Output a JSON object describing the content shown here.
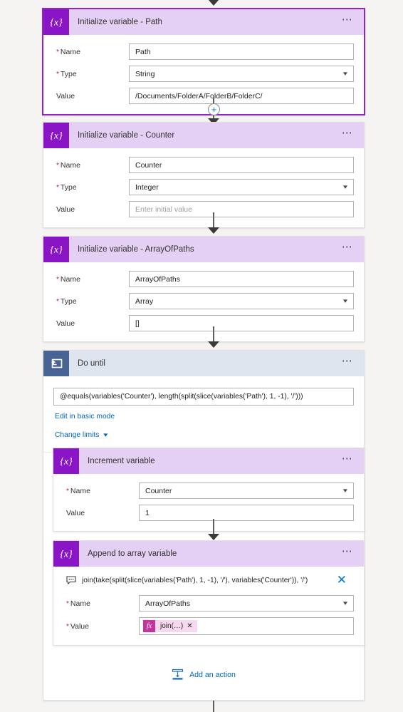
{
  "flow": {
    "cards": [
      {
        "id": "init-path",
        "title": "Initialize variable - Path",
        "icon": "variable-braces-icon",
        "selected": true,
        "fields": [
          {
            "label": "Name",
            "required": true,
            "value": "Path",
            "control": "text"
          },
          {
            "label": "Type",
            "required": true,
            "value": "String",
            "control": "dropdown"
          },
          {
            "label": "Value",
            "required": false,
            "value": "/Documents/FolderA/FolderB/FolderC/",
            "control": "text"
          }
        ]
      },
      {
        "id": "init-counter",
        "title": "Initialize variable - Counter",
        "icon": "variable-braces-icon",
        "selected": false,
        "fields": [
          {
            "label": "Name",
            "required": true,
            "value": "Counter",
            "control": "text"
          },
          {
            "label": "Type",
            "required": true,
            "value": "Integer",
            "control": "dropdown"
          },
          {
            "label": "Value",
            "required": false,
            "value": "",
            "placeholder": "Enter initial value",
            "control": "text"
          }
        ]
      },
      {
        "id": "init-arrayofpaths",
        "title": "Initialize variable - ArrayOfPaths",
        "icon": "variable-braces-icon",
        "selected": false,
        "fields": [
          {
            "label": "Name",
            "required": true,
            "value": "ArrayOfPaths",
            "control": "text"
          },
          {
            "label": "Type",
            "required": true,
            "value": "Array",
            "control": "dropdown"
          },
          {
            "label": "Value",
            "required": false,
            "value": "[]",
            "control": "text"
          }
        ]
      }
    ],
    "do_until": {
      "title": "Do until",
      "icon": "do-until-loop-icon",
      "condition": "@equals(variables('Counter'), length(split(slice(variables('Path'), 1, -1), '/')))",
      "basic_mode_link": "Edit in basic mode",
      "change_limits_link": "Change limits",
      "add_action_label": "Add an action",
      "add_action_icon": "insert-action-icon",
      "inner_cards": [
        {
          "id": "increment-variable",
          "title": "Increment variable",
          "icon": "variable-braces-icon",
          "fields": [
            {
              "label": "Name",
              "required": true,
              "value": "Counter",
              "control": "dropdown"
            },
            {
              "label": "Value",
              "required": false,
              "value": "1",
              "control": "text"
            }
          ]
        },
        {
          "id": "append-to-array-variable",
          "title": "Append to array variable",
          "icon": "variable-braces-icon",
          "comment": {
            "icon": "comment-bubble-icon",
            "text": "join(take(split(slice(variables('Path'), 1, -1), '/'), variables('Counter')), '/')",
            "dismiss_icon": "close-icon"
          },
          "fields": [
            {
              "label": "Name",
              "required": true,
              "value": "ArrayOfPaths",
              "control": "dropdown"
            },
            {
              "label": "Value",
              "required": true,
              "control": "token",
              "token": {
                "fx": "fx",
                "label": "join(…)",
                "remove": "✕"
              }
            }
          ]
        }
      ]
    }
  },
  "colors": {
    "variable_tile": "#8a15c7",
    "variable_header": "#e5d0f5",
    "loop_tile": "#486494",
    "loop_header": "#dee5ef",
    "selected_border": "#8c27c4",
    "link": "#0067b8",
    "required_asterisk": "#a4262c",
    "token_fx": "#c2359d",
    "token_body": "#f6d9ef",
    "canvas": "#f5f4f3"
  }
}
